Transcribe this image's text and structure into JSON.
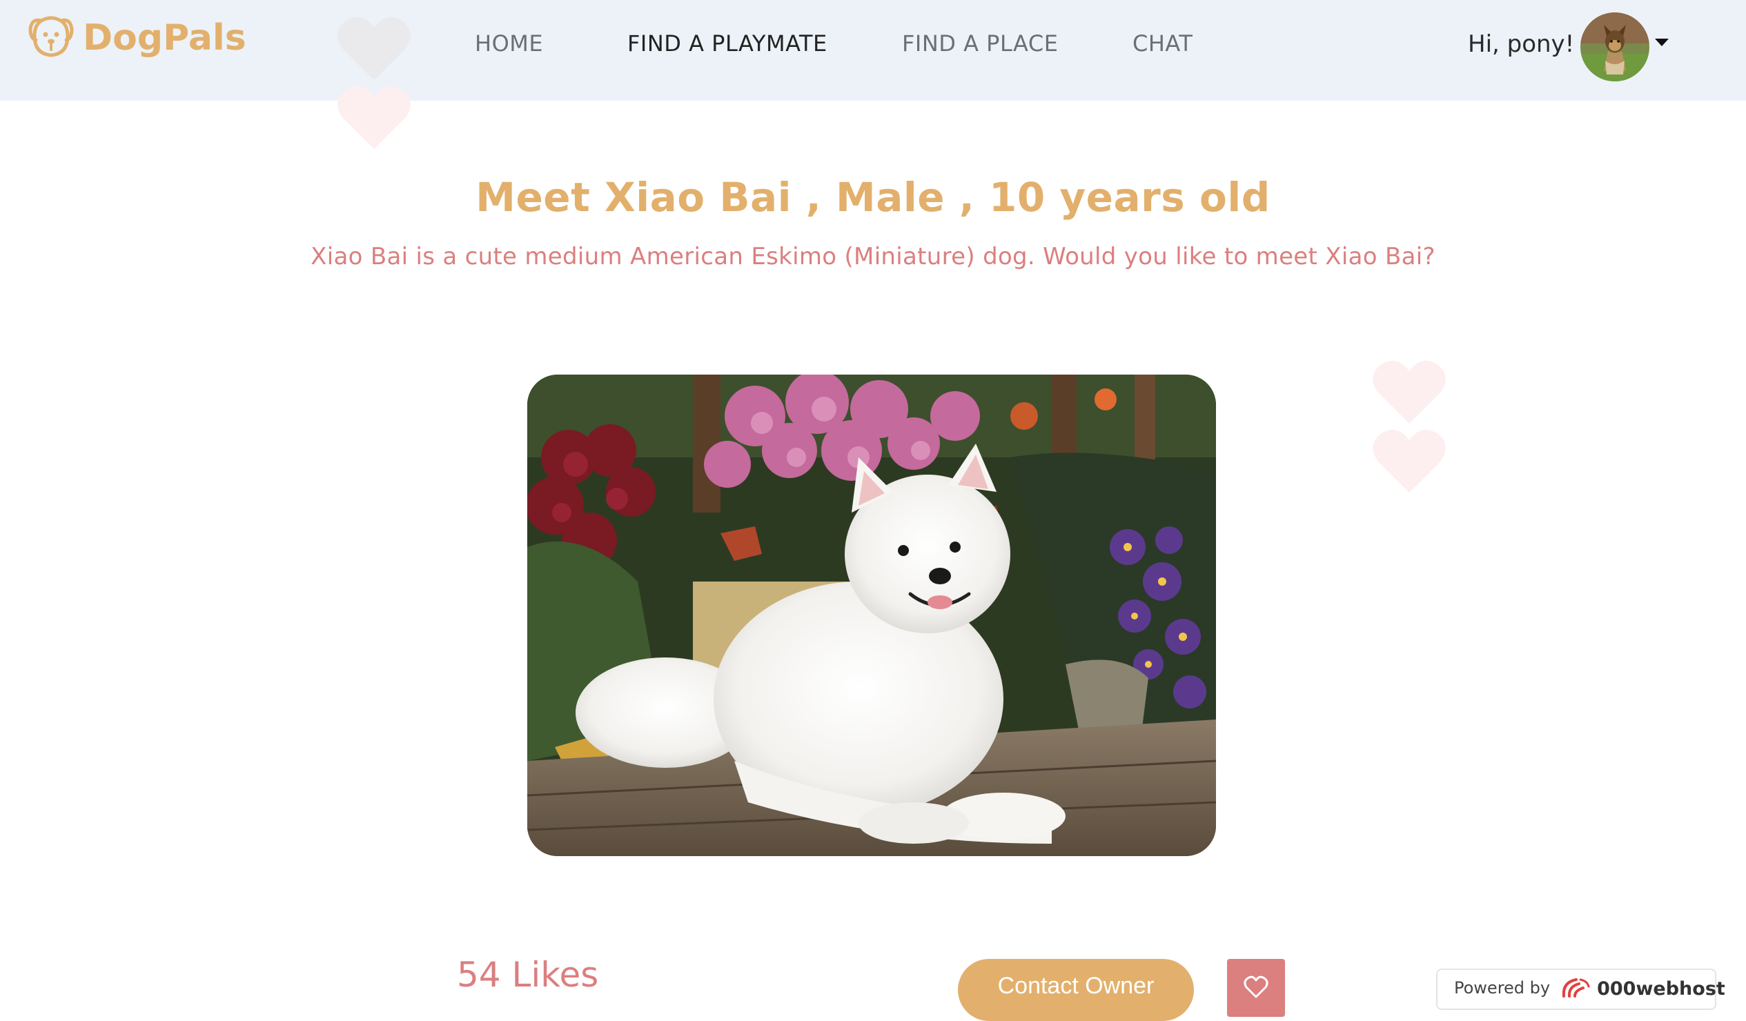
{
  "navbar": {
    "brand": "DogPals",
    "links": [
      {
        "label": "HOME",
        "active": false
      },
      {
        "label": "FIND A PLAYMATE",
        "active": true
      },
      {
        "label": "FIND A PLACE",
        "active": false
      },
      {
        "label": "CHAT",
        "active": false
      }
    ],
    "greeting": "Hi, pony!",
    "avatar_icon": "yorkshire-terrier-avatar",
    "menu_icon": "caret-down-icon"
  },
  "profile": {
    "title": "Meet Xiao Bai , Male , 10 years old",
    "description": "Xiao Bai is a cute medium American Eskimo (Miniature) dog. Would you like to meet Xiao Bai?",
    "photo": "white-american-eskimo-dog-among-flowers",
    "likes": "54 Likes",
    "contact_label": "Contact Owner",
    "like_icon": "heart-outline-icon"
  },
  "footer_badge": {
    "powered_by": "Powered by",
    "brand": "000webhost"
  },
  "colors": {
    "brand_gold": "#e2b06c",
    "accent_pink": "#db7f7f",
    "navbar_bg": "#ecf2f8"
  }
}
